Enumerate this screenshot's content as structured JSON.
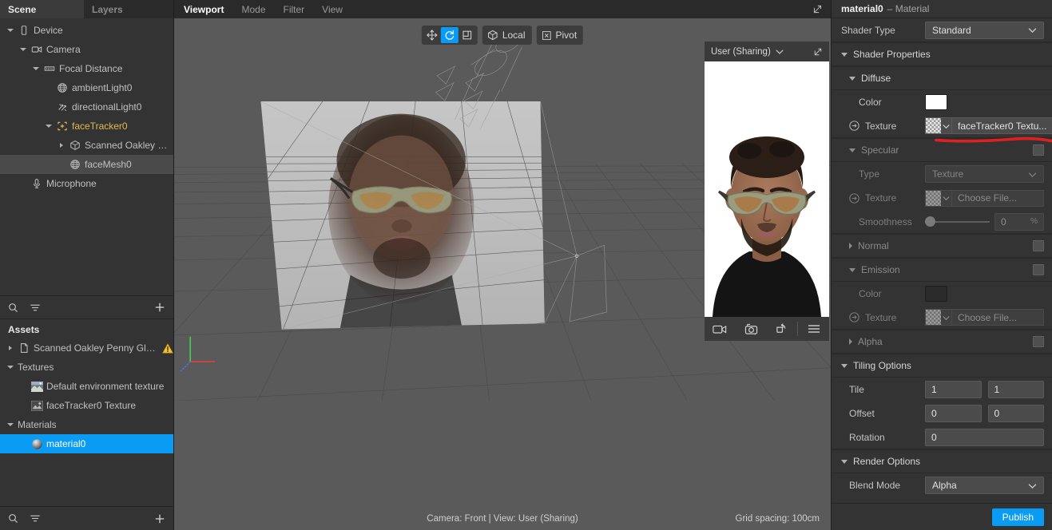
{
  "left_panel": {
    "tabs": [
      {
        "label": "Scene",
        "active": true
      },
      {
        "label": "Layers",
        "active": false
      }
    ],
    "scene_tree": [
      {
        "label": "Device",
        "depth": 0,
        "twisty": "open",
        "icon": "device-icon",
        "selected": false,
        "accent": false
      },
      {
        "label": "Camera",
        "depth": 1,
        "twisty": "open",
        "icon": "camera-icon",
        "selected": false,
        "accent": false
      },
      {
        "label": "Focal Distance",
        "depth": 2,
        "twisty": "open",
        "icon": "focal-distance-icon",
        "selected": false,
        "accent": false
      },
      {
        "label": "ambientLight0",
        "depth": 3,
        "twisty": "none",
        "icon": "ambient-light-icon",
        "selected": false,
        "accent": false
      },
      {
        "label": "directionalLight0",
        "depth": 3,
        "twisty": "none",
        "icon": "directional-light-icon",
        "selected": false,
        "accent": false
      },
      {
        "label": "faceTracker0",
        "depth": 3,
        "twisty": "open",
        "icon": "face-tracker-icon",
        "selected": false,
        "accent": true
      },
      {
        "label": "Scanned Oakley Penny Gl...",
        "depth": 4,
        "twisty": "closed",
        "icon": "mesh-object-icon",
        "selected": false,
        "accent": false
      },
      {
        "label": "faceMesh0",
        "depth": 4,
        "twisty": "none",
        "icon": "face-mesh-icon",
        "selected": true,
        "accent": false
      },
      {
        "label": "Microphone",
        "depth": 1,
        "twisty": "none",
        "icon": "microphone-icon",
        "selected": false,
        "accent": false
      }
    ],
    "scene_toolbar": {
      "search": "search-icon",
      "filter": "filter-icon",
      "add": "plus-icon"
    },
    "assets_title": "Assets",
    "assets_tree": [
      {
        "label": "Scanned Oakley Penny Glasses",
        "depth": 0,
        "twisty": "closed",
        "icon": "file-icon",
        "selected": false,
        "warning": true
      },
      {
        "label": "Textures",
        "depth": 0,
        "twisty": "open",
        "icon": "none",
        "selected": false,
        "warning": false
      },
      {
        "label": "Default environment texture",
        "depth": 1,
        "twisty": "none",
        "icon": "thumb-env-icon",
        "selected": false,
        "warning": false
      },
      {
        "label": "faceTracker0 Texture",
        "depth": 1,
        "twisty": "none",
        "icon": "thumb-tex-icon",
        "selected": false,
        "warning": false
      },
      {
        "label": "Materials",
        "depth": 0,
        "twisty": "open",
        "icon": "none",
        "selected": false,
        "warning": false
      },
      {
        "label": "material0",
        "depth": 1,
        "twisty": "none",
        "icon": "material-ball-icon",
        "selected": true,
        "warning": false
      }
    ],
    "assets_toolbar": {
      "search": "search-icon",
      "filter": "filter-icon",
      "add": "plus-icon"
    }
  },
  "viewport": {
    "menus": [
      {
        "label": "Viewport",
        "active": true
      },
      {
        "label": "Mode",
        "active": false
      },
      {
        "label": "Filter",
        "active": false
      },
      {
        "label": "View",
        "active": false
      }
    ],
    "popout_icon": "popout-icon",
    "gizmo_tools": [
      {
        "name": "translate-tool",
        "icon": "move-icon",
        "active": false
      },
      {
        "name": "rotate-tool",
        "icon": "rotate-icon",
        "active": true
      },
      {
        "name": "scale-tool",
        "icon": "scale-icon",
        "active": false
      }
    ],
    "space_toggle": {
      "label": "Local",
      "icon": "cube-icon"
    },
    "pivot_toggle": {
      "label": "Pivot",
      "icon": "pivot-icon"
    },
    "status_text": "Camera: Front | View: User (Sharing)",
    "grid_spacing": "Grid spacing: 100cm",
    "axis_gizmo": {
      "x_color": "#e04040",
      "y_color": "#3fd24a",
      "z_color": "#3a78e8"
    }
  },
  "preview": {
    "device_label": "User (Sharing)",
    "caret_icon": "chevron-down-icon",
    "popout_icon": "popout-icon",
    "footer_buttons": [
      {
        "name": "record-video-button",
        "icon": "video-camera-icon"
      },
      {
        "name": "capture-photo-button",
        "icon": "photo-rotate-icon"
      },
      {
        "name": "reset-button",
        "icon": "reset-arrow-icon"
      },
      {
        "name": "preview-menu-button",
        "icon": "hamburger-icon"
      }
    ]
  },
  "inspector": {
    "title": "material0",
    "subtitle": "– Material",
    "shader_type": {
      "label": "Shader Type",
      "value": "Standard"
    },
    "sections": {
      "shader_properties": "Shader Properties",
      "diffuse": "Diffuse",
      "specular": "Specular",
      "normal": "Normal",
      "emission": "Emission",
      "alpha": "Alpha",
      "tiling_options": "Tiling Options",
      "render_options": "Render Options"
    },
    "diffuse": {
      "color_label": "Color",
      "color_value": "#ffffff",
      "texture_label": "Texture",
      "texture_value": "faceTracker0 Textu..."
    },
    "specular": {
      "type_label": "Type",
      "type_value": "Texture",
      "texture_label": "Texture",
      "texture_value": "Choose File...",
      "smoothness_label": "Smoothness",
      "smoothness_value": "0",
      "smoothness_unit": "%"
    },
    "emission": {
      "color_label": "Color",
      "color_value": "#2a2a2a",
      "texture_label": "Texture",
      "texture_value": "Choose File..."
    },
    "tiling": {
      "tile_label": "Tile",
      "tile_x": "1",
      "tile_y": "1",
      "offset_label": "Offset",
      "offset_x": "0",
      "offset_y": "0",
      "rotation_label": "Rotation",
      "rotation": "0"
    },
    "render": {
      "blend_mode_label": "Blend Mode",
      "blend_mode_value": "Alpha"
    },
    "publish_label": "Publish",
    "annotation": {
      "type": "red-underline",
      "color": "#e02020"
    }
  },
  "colors": {
    "accent": "#0a9cf5",
    "panel_bg": "#333333",
    "viewport_bg": "#5a5a5a",
    "selection": "#0a9cf5",
    "tree_selection": "#4a4a4a",
    "warning": "#f0c330",
    "tracker_yellow": "#e0bb52"
  }
}
